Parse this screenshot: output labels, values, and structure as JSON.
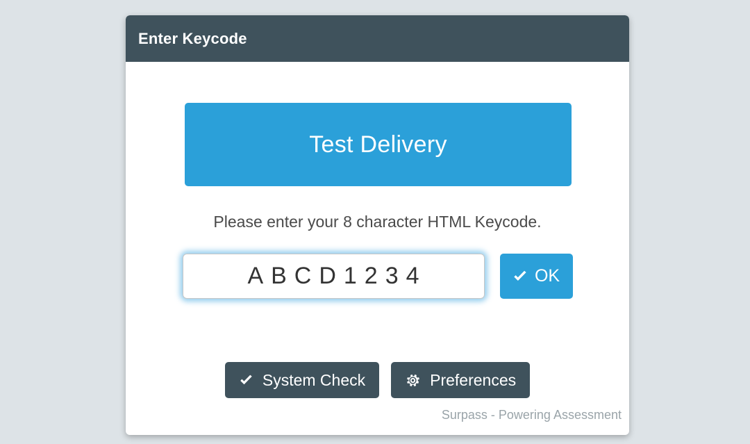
{
  "page": {
    "background_color": "#dde3e7"
  },
  "dialog": {
    "title": "Enter Keycode",
    "header_color": "#3f525c",
    "background_color": "#ffffff"
  },
  "primary_action": {
    "label": "Test Delivery",
    "color": "#2ba0d9"
  },
  "instruction": {
    "text": "Please enter your 8 character HTML Keycode."
  },
  "keycode": {
    "value": "ABCD1234",
    "placeholder": "",
    "focused": true,
    "focus_glow_color": "#74bfe8",
    "ok_button": {
      "label": "OK",
      "icon": "check-icon",
      "color": "#2ba0d9"
    }
  },
  "footer_buttons": [
    {
      "label": "System Check",
      "icon": "check-icon",
      "color": "#3f525c"
    },
    {
      "label": "Preferences",
      "icon": "gear-icon",
      "color": "#3f525c"
    }
  ],
  "branding": {
    "text": "Surpass - Powering Assessment",
    "color": "#9aa4a9"
  }
}
